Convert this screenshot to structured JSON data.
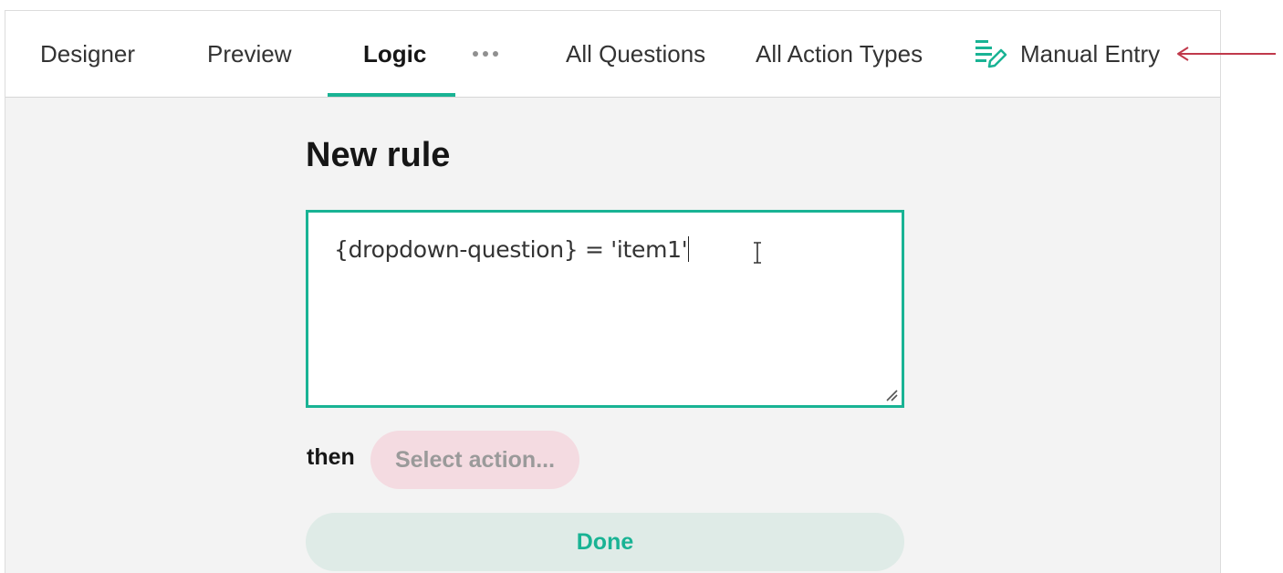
{
  "tabs": {
    "designer": "Designer",
    "preview": "Preview",
    "logic": "Logic",
    "all_questions": "All Questions",
    "all_action_types": "All Action Types",
    "manual_entry": "Manual Entry"
  },
  "icons": {
    "more": "more-horizontal-icon",
    "manual_entry": "list-pencil-icon",
    "resize": "resize-handle-icon",
    "cursor": "text-cursor-icon",
    "annotation": "arrow-left-icon"
  },
  "colors": {
    "accent": "#19b394",
    "annotation_arrow": "#c0394b",
    "select_action_bg": "#f4dbe1",
    "done_bg": "#dfebe7"
  },
  "rule": {
    "title": "New rule",
    "expression": "{dropdown-question} = 'item1'",
    "then_label": "then",
    "select_action_placeholder": "Select action...",
    "done_label": "Done"
  }
}
